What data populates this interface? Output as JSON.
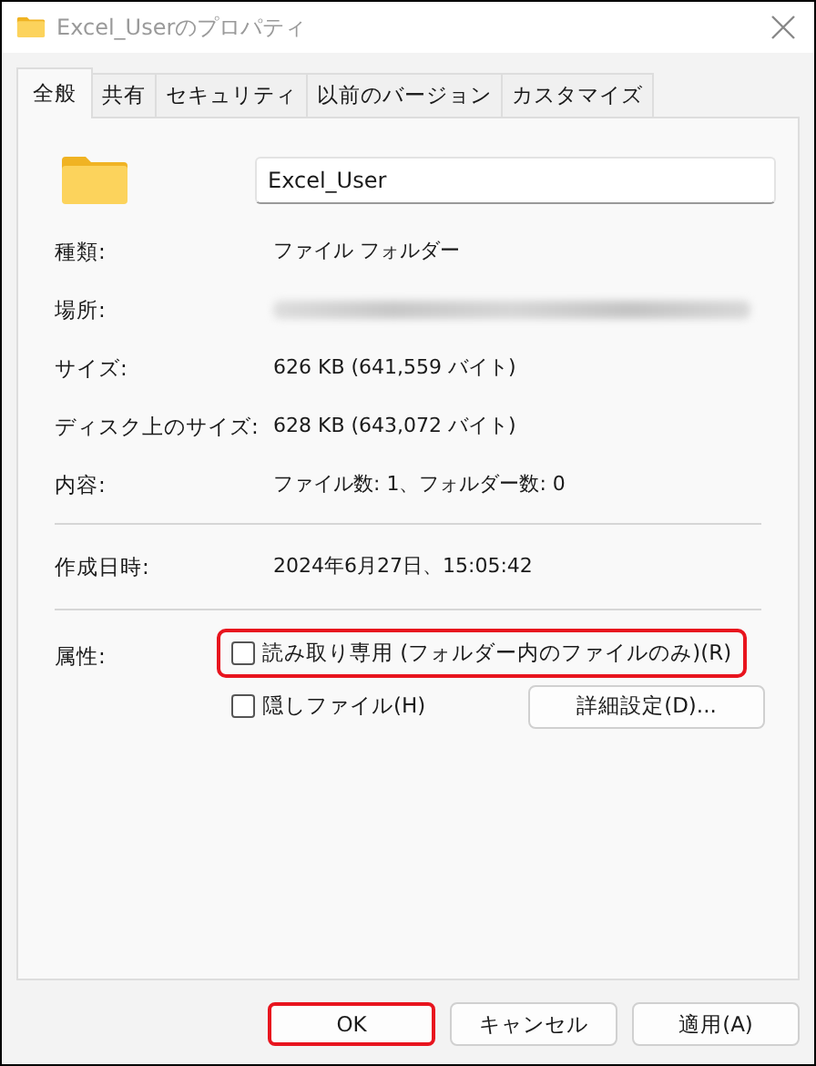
{
  "window": {
    "title": "Excel_Userのプロパティ"
  },
  "tabs": [
    {
      "label": "全般",
      "selected": true
    },
    {
      "label": "共有",
      "selected": false
    },
    {
      "label": "セキュリティ",
      "selected": false
    },
    {
      "label": "以前のバージョン",
      "selected": false
    },
    {
      "label": "カスタマイズ",
      "selected": false
    }
  ],
  "name_field": {
    "value": "Excel_User"
  },
  "properties": [
    {
      "label": "種類:",
      "value": "ファイル フォルダー"
    },
    {
      "label": "場所:",
      "kind": "redacted"
    },
    {
      "label": "サイズ:",
      "value": "626 KB (641,559 バイト)"
    },
    {
      "label": "ディスク上のサイズ:",
      "value": "628 KB (643,072 バイト)"
    },
    {
      "label": "内容:",
      "value": "ファイル数: 1、フォルダー数: 0"
    }
  ],
  "created": {
    "label": "作成日時:",
    "value": "2024年6月27日、15:05:42"
  },
  "attributes": {
    "label": "属性:",
    "checkboxes": [
      {
        "label": "読み取り専用 (フォルダー内のファイルのみ)(R)",
        "checked": false,
        "highlighted": true
      },
      {
        "label": "隠しファイル(H)",
        "checked": false,
        "highlighted": false
      }
    ],
    "advanced_button": "詳細設定(D)..."
  },
  "buttons": [
    {
      "label": "OK",
      "highlighted": true
    },
    {
      "label": "キャンセル",
      "highlighted": false
    },
    {
      "label": "適用(A)",
      "highlighted": false
    }
  ]
}
